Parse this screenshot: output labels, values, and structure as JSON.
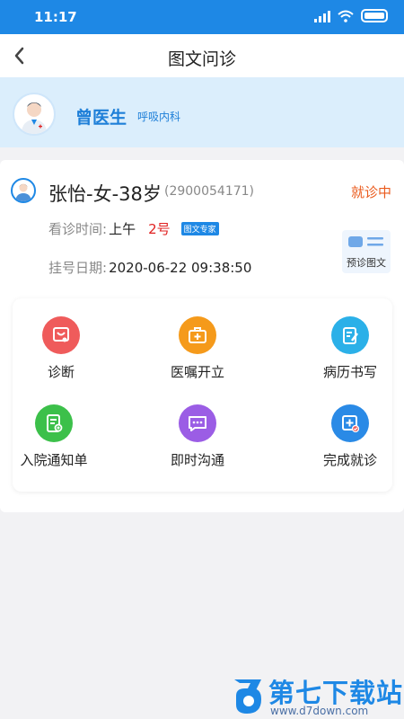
{
  "status_bar": {
    "time": "11:17"
  },
  "nav": {
    "title": "图文问诊"
  },
  "doctor": {
    "name": "曾医生",
    "department": "呼吸内科"
  },
  "patient": {
    "name_info": "张怡-女-38岁",
    "id": "(2900054171)",
    "status": "就诊中",
    "visit_time_label": "看诊时间:",
    "visit_period": "上午",
    "visit_number": "2号",
    "visit_tag": "图文专家",
    "register_date_label": "挂号日期:",
    "register_date": "2020-06-22 09:38:50",
    "preview_label": "预诊图文"
  },
  "actions": [
    {
      "label": "诊断",
      "icon": "diagnosis-icon",
      "color": "#ef5b5b"
    },
    {
      "label": "医嘱开立",
      "icon": "medical-kit-icon",
      "color": "#f59a1b"
    },
    {
      "label": "病历书写",
      "icon": "record-write-icon",
      "color": "#2bb0e8"
    },
    {
      "label": "入院通知单",
      "icon": "admission-notice-icon",
      "color": "#3cc04a"
    },
    {
      "label": "即时沟通",
      "icon": "chat-icon",
      "color": "#9b5de5"
    },
    {
      "label": "完成就诊",
      "icon": "complete-visit-icon",
      "color": "#2a8ae6"
    }
  ],
  "watermark": {
    "text": "第七下载站",
    "url": "www.d7down.com"
  },
  "colors": {
    "primary": "#1e88e5",
    "status": "#ea5a1c",
    "doctor_bg": "#dbeefc"
  }
}
